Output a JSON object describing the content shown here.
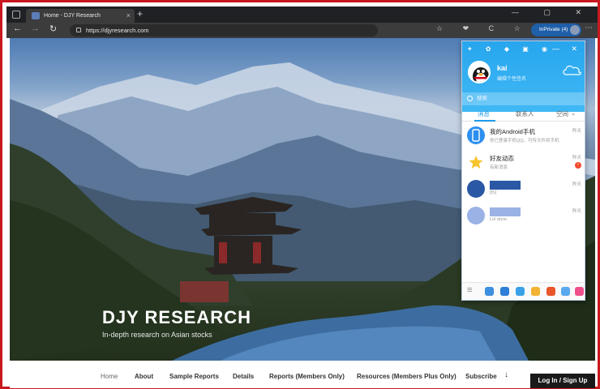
{
  "browser": {
    "tab_title": "Home - DJY Research",
    "url": "https://djyresearch.com",
    "inprivate_label": "InPrivate (4)",
    "close_glyph": "×",
    "newtab_glyph": "+",
    "back_glyph": "←",
    "forward_glyph": "→",
    "reload_glyph": "↻",
    "window_controls": "— ▢ ✕",
    "toolbar_icons": "☆ ❤ C ☆ ⧉",
    "more_glyph": "⋯"
  },
  "site": {
    "title": "DJY RESEARCH",
    "subtitle": "In-depth research on Asian stocks",
    "nav": [
      "Home",
      "About",
      "Sample Reports",
      "Details",
      "Reports (Members Only)",
      "Resources (Members Plus Only)",
      "Subscribe"
    ],
    "search_glyph": "↓",
    "login_label": "Log In / Sign Up"
  },
  "qq": {
    "user_name": "kai",
    "signature": "编辑个性签名",
    "search_placeholder": "搜索",
    "top_icons": "✦ ✿ ◆ ▣ ◉",
    "win_buttons": "— ✕",
    "tabs": [
      "消息",
      "联系人",
      "空间"
    ],
    "space_chevron": "⌄",
    "items": [
      {
        "title": "我的Android手机",
        "desc": "你已登录手机QQ，可传文件到手机",
        "time": "昨天"
      },
      {
        "title": "好友动态",
        "desc": "有新消息",
        "time": "昨天",
        "badge": "!"
      },
      {
        "title": "",
        "desc": "[fS]",
        "time": "昨天"
      },
      {
        "title": "",
        "desc": "Lol done.",
        "time": "昨天"
      }
    ],
    "menu_glyph": "≡",
    "colors": {
      "header": "#27a6ee",
      "accent": "#1e9be8",
      "badge": "#f04b2d"
    }
  }
}
